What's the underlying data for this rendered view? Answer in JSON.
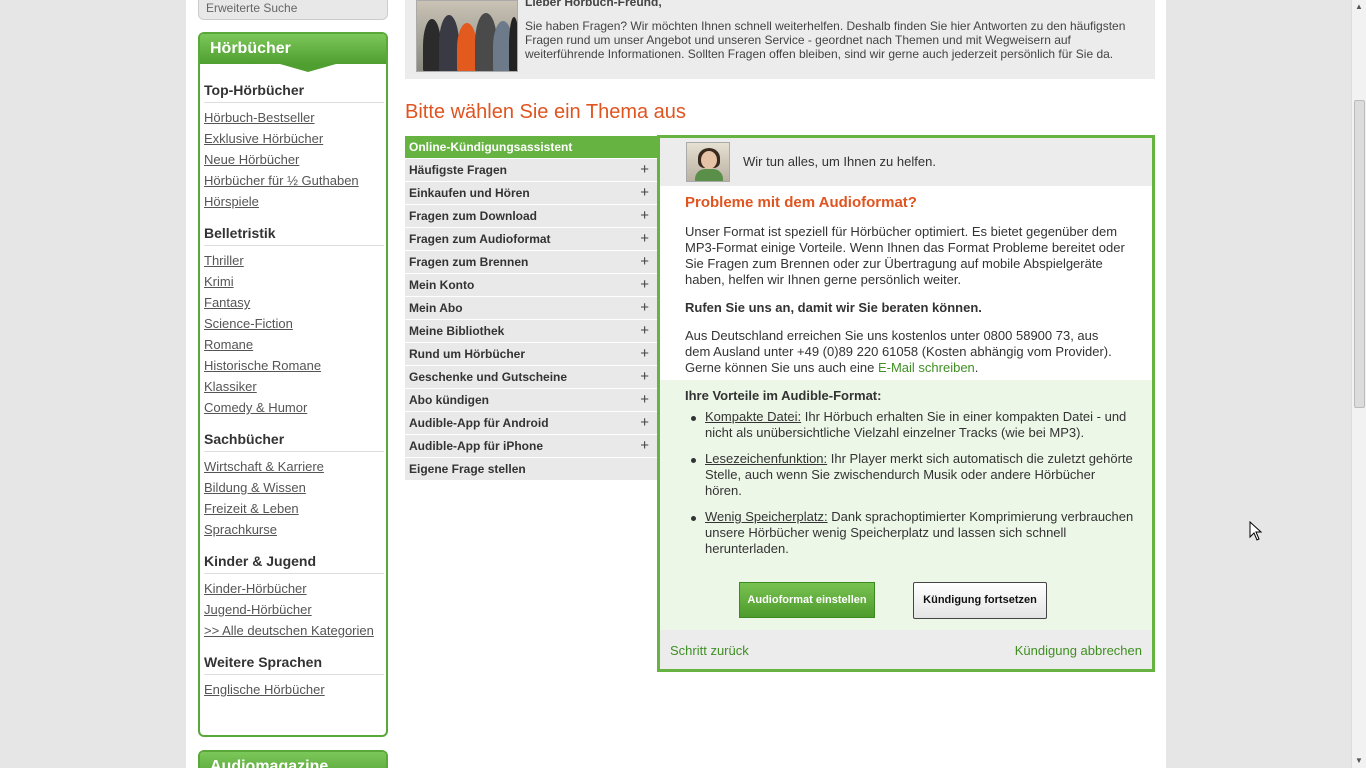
{
  "sidebar": {
    "advanced_search": "Erweiterte Suche",
    "box_title": "Hörbücher",
    "groups": [
      {
        "title": "Top-Hörbücher",
        "links": [
          "Hörbuch-Bestseller",
          "Exklusive Hörbücher",
          "Neue Hörbücher",
          "Hörbücher für ½ Guthaben",
          "Hörspiele"
        ]
      },
      {
        "title": "Belletristik",
        "links": [
          "Thriller",
          "Krimi",
          "Fantasy",
          "Science-Fiction",
          "Romane",
          "Historische Romane",
          "Klassiker",
          "Comedy & Humor"
        ]
      },
      {
        "title": "Sachbücher",
        "links": [
          "Wirtschaft & Karriere",
          "Bildung & Wissen",
          "Freizeit & Leben",
          "Sprachkurse"
        ]
      },
      {
        "title": "Kinder & Jugend",
        "links": [
          "Kinder-Hörbücher",
          "Jugend-Hörbücher",
          ">> Alle deutschen Kategorien"
        ]
      },
      {
        "title": "Weitere Sprachen",
        "links": [
          "Englische Hörbücher"
        ]
      }
    ],
    "box2_title": "Audiomagazine"
  },
  "intro": {
    "greeting": "Lieber Hörbuch-Freund,",
    "text": "Sie haben Fragen? Wir möchten Ihnen schnell weiterhelfen. Deshalb finden Sie hier Antworten zu den häufigsten Fragen rund um unser Angebot und unseren Service - geordnet nach Themen und mit Wegweisern auf weiterführende Informationen. Sollten Fragen offen bleiben, sind wir gerne auch jederzeit persönlich für Sie da."
  },
  "main": {
    "section_title": "Bitte wählen Sie ein Thema aus",
    "topics": [
      {
        "label": "Online-Kündigungsassistent",
        "plus": ""
      },
      {
        "label": "Häufigste Fragen",
        "plus": "+"
      },
      {
        "label": "Einkaufen und Hören",
        "plus": "+"
      },
      {
        "label": "Fragen zum Download",
        "plus": "+"
      },
      {
        "label": "Fragen zum Audioformat",
        "plus": "+"
      },
      {
        "label": "Fragen zum Brennen",
        "plus": "+"
      },
      {
        "label": "Mein Konto",
        "plus": "+"
      },
      {
        "label": "Mein Abo",
        "plus": "+"
      },
      {
        "label": "Meine Bibliothek",
        "plus": "+"
      },
      {
        "label": "Rund um Hörbücher",
        "plus": "+"
      },
      {
        "label": "Geschenke und Gutscheine",
        "plus": "+"
      },
      {
        "label": "Abo kündigen",
        "plus": "+"
      },
      {
        "label": "Audible-App für Android",
        "plus": "+"
      },
      {
        "label": "Audible-App für iPhone",
        "plus": "+"
      },
      {
        "label": "Eigene Frage stellen",
        "plus": ""
      }
    ]
  },
  "panel": {
    "help_text": "Wir tun alles, um Ihnen zu helfen.",
    "title": "Probleme mit dem Audioformat?",
    "p1": "Unser Format ist speziell für Hörbücher optimiert. Es bietet gegenüber dem MP3-Format einige Vorteile. Wenn Ihnen das Format Probleme bereitet oder Sie Fragen zum Brennen oder zur Übertragung auf mobile Abspielgeräte haben, helfen wir Ihnen gerne persönlich weiter.",
    "call": "Rufen Sie uns an, damit wir Sie beraten können.",
    "p2": "Aus Deutschland erreichen Sie uns kostenlos unter 0800 58900 73, aus dem Ausland unter +49 (0)89 220 61058 (Kosten abhängig vom Provider). Gerne können Sie uns auch eine ",
    "email_link": "E-Mail schreiben",
    "p2_end": ".",
    "benefits_title": "Ihre Vorteile im Audible-Format:",
    "benefits": [
      {
        "term": "Kompakte Datei:",
        "text": " Ihr Hörbuch erhalten Sie in einer kompakten Datei - und nicht als unübersichtliche Vielzahl einzelner Tracks (wie bei MP3)."
      },
      {
        "term": "Lesezeichenfunktion:",
        "text": " Ihr Player merkt sich automatisch die zuletzt gehörte Stelle, auch wenn Sie zwischendurch Musik oder andere Hörbücher hören."
      },
      {
        "term": "Wenig Speicherplatz:",
        "text": " Dank sprachoptimierter Komprimierung verbrauchen unsere Hörbücher wenig Speicherplatz und lassen sich schnell herunterladen."
      }
    ],
    "btn_audioformat": "Audioformat einstellen",
    "btn_continue": "Kündigung fortsetzen",
    "back": "Schritt zurück",
    "cancel": "Kündigung abbrechen"
  },
  "colors": {
    "accent_green": "#66b342",
    "title_orange": "#e0541f",
    "link_green": "#3f8f22"
  }
}
